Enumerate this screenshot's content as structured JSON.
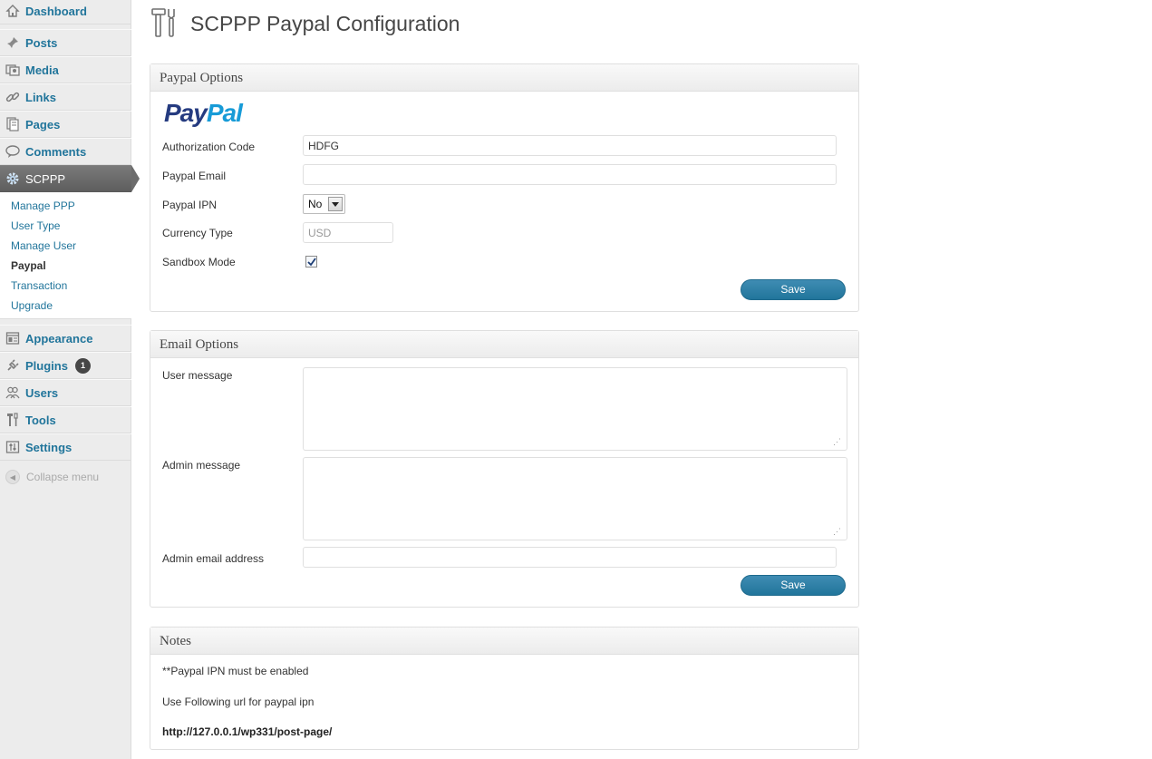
{
  "sidebar": {
    "items": [
      {
        "label": "Dashboard",
        "icon": "dashboard-icon"
      },
      {
        "label": "Posts",
        "icon": "pushpin-icon"
      },
      {
        "label": "Media",
        "icon": "media-icon"
      },
      {
        "label": "Links",
        "icon": "link-icon"
      },
      {
        "label": "Pages",
        "icon": "pages-icon"
      },
      {
        "label": "Comments",
        "icon": "comment-icon"
      },
      {
        "label": "SCPPP",
        "icon": "gear-icon"
      },
      {
        "label": "Appearance",
        "icon": "appearance-icon"
      },
      {
        "label": "Plugins",
        "icon": "plugin-icon",
        "badge": "1"
      },
      {
        "label": "Users",
        "icon": "users-icon"
      },
      {
        "label": "Tools",
        "icon": "tools-icon"
      },
      {
        "label": "Settings",
        "icon": "settings-icon"
      }
    ],
    "submenu": [
      "Manage PPP",
      "User Type",
      "Manage User",
      "Paypal",
      "Transaction",
      "Upgrade"
    ],
    "current_submenu": "Paypal",
    "collapse_label": "Collapse menu"
  },
  "page": {
    "title": "SCPPP Paypal Configuration",
    "title_icon": "tools-icon"
  },
  "paypal_options": {
    "heading": "Paypal Options",
    "logo_text_pay": "Pay",
    "logo_text_pal": "Pal",
    "auth_code_label": "Authorization Code",
    "auth_code_value": "HDFG",
    "email_label": "Paypal Email",
    "email_value": "",
    "ipn_label": "Paypal IPN",
    "ipn_value": "No",
    "currency_label": "Currency Type",
    "currency_value": "USD",
    "sandbox_label": "Sandbox Mode",
    "sandbox_checked": true,
    "save_label": "Save"
  },
  "email_options": {
    "heading": "Email Options",
    "user_message_label": "User message",
    "admin_message_label": "Admin message",
    "admin_email_label": "Admin email address",
    "admin_email_value": "",
    "save_label": "Save"
  },
  "notes": {
    "heading": "Notes",
    "line1": "**Paypal IPN must be enabled",
    "line2": "Use Following url for paypal ipn",
    "url": "http://127.0.0.1/wp331/post-page/"
  },
  "colors": {
    "link": "#21759b",
    "button": "#21759b",
    "sidebar_bg": "#ececec",
    "active_menu": "#6c6c6c"
  }
}
